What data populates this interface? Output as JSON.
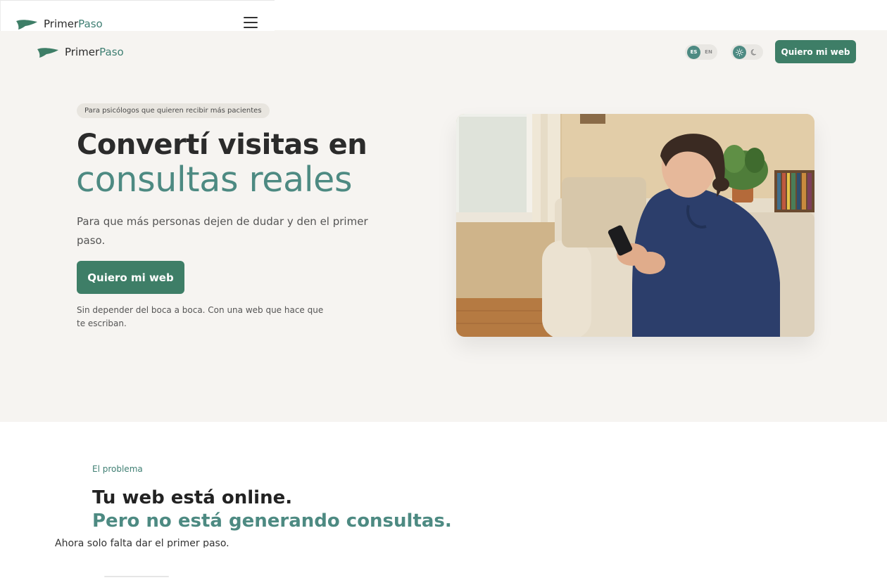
{
  "brand": {
    "primary": "Primer",
    "accent": "Paso"
  },
  "mobile_header": {
    "menu_icon": "hamburger-menu-icon"
  },
  "nav": {
    "languages": [
      "ES",
      "EN"
    ],
    "active_language": "ES",
    "theme_icons": [
      "sun-icon",
      "moon-icon"
    ],
    "active_theme": "light",
    "cta_label": "Quiero mi web"
  },
  "hero": {
    "tag": "Para psicólogos que quieren recibir más pacientes",
    "title_line1": "Convertí visitas en",
    "title_line2": "consultas reales",
    "subtitle": "Para que más personas dejen de dudar y den el primer paso.",
    "cta_label": "Quiero mi web",
    "note": "Sin depender del boca a boca. Con una web que hace que te escriban.",
    "image_description": "woman-on-sofa-with-phone"
  },
  "problem": {
    "eyebrow": "El problema",
    "title_line1": "Tu web está online.",
    "title_line2": "Pero no está generando consultas.",
    "clipped_text": "Ahora solo falta dar el primer paso."
  },
  "colors": {
    "brand_green": "#3e7e67",
    "accent_teal": "#4d8a82",
    "hero_bg": "#f6f4f1"
  }
}
